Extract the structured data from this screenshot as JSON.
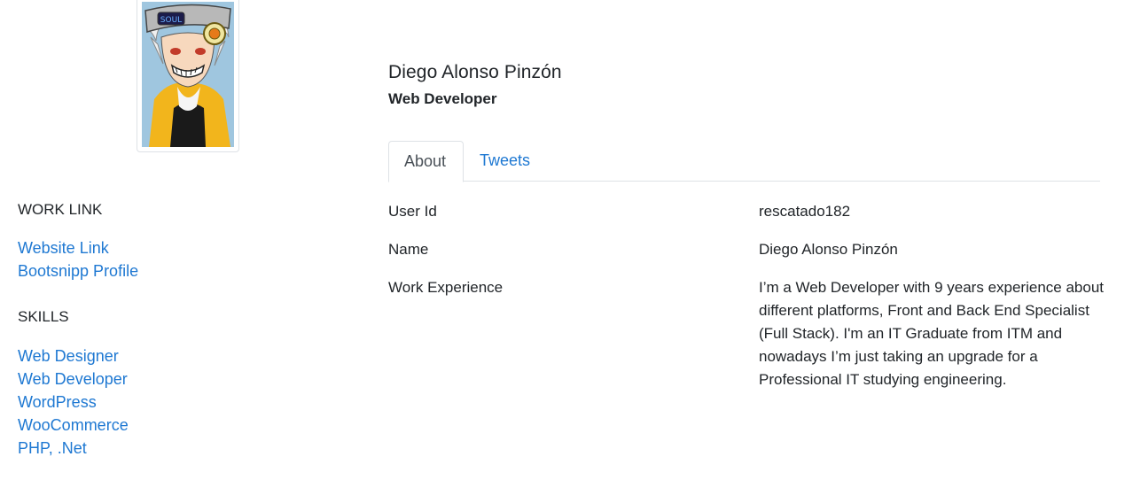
{
  "profile": {
    "name": "Diego Alonso Pinzón",
    "role": "Web Developer"
  },
  "tabs": [
    {
      "label": "About",
      "active": true
    },
    {
      "label": "Tweets",
      "active": false
    }
  ],
  "sidebar": {
    "work_link": {
      "title": "WORK LINK",
      "links": [
        "Website Link",
        "Bootsnipp Profile"
      ]
    },
    "skills": {
      "title": "SKILLS",
      "items": [
        "Web Designer",
        "Web Developer",
        "WordPress",
        "WooCommerce",
        "PHP, .Net"
      ]
    }
  },
  "about": {
    "rows": [
      {
        "label": "User Id",
        "value": "rescatado182"
      },
      {
        "label": "Name",
        "value": "Diego Alonso Pinzón"
      },
      {
        "label": "Work Experience",
        "value": "I’m a Web Developer with 9 years experience about different platforms, Front and Back End Specialist (Full Stack). I'm an IT Graduate from ITM and nowadays I’m just taking an upgrade for a Professional IT studying engineering."
      }
    ]
  },
  "colors": {
    "link": "#1e78d2",
    "text": "#212529",
    "border": "#dee2e6"
  },
  "avatar": {
    "headband_text": "SOUL"
  }
}
